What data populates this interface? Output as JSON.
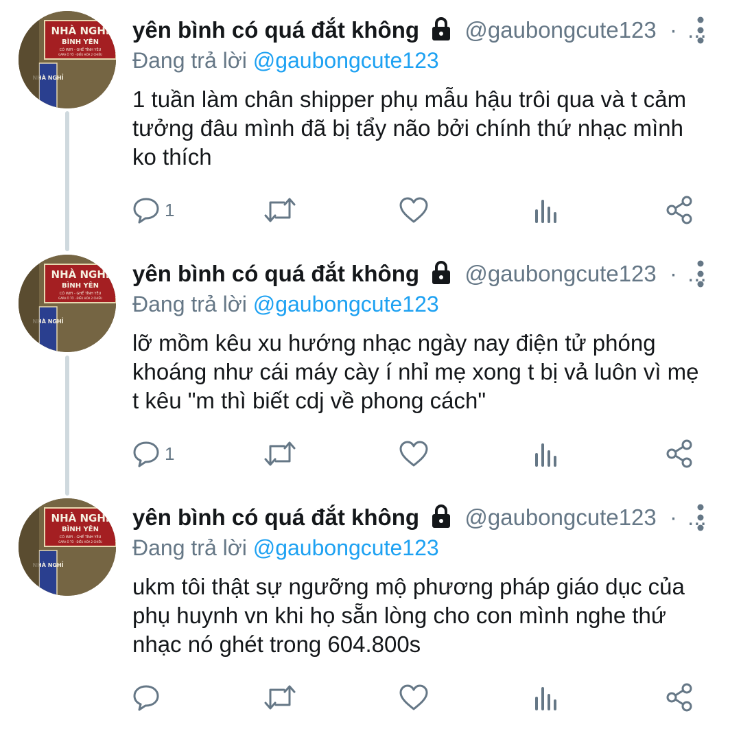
{
  "colors": {
    "text": "#14171a",
    "secondary": "#657786",
    "link": "#1da1f2",
    "thread_line": "#cfd9de"
  },
  "avatar_sign": {
    "line1": "NHÀ NGHỈ",
    "line2": "BÌNH YÊN",
    "line3": "CÓ WIFI - GHẾ TÌNH YÊU",
    "line4": "GARA Ô TÔ - ĐIỀU HÒA 2 CHIỀU",
    "side": "NHÀ NGHỈ"
  },
  "tweets": [
    {
      "display_name": "yên bình có quá đắt không",
      "handle": "@gaubongcute123",
      "separator": "·",
      "ellipsis": "...",
      "replying_prefix": "Đang trả lời",
      "replying_to": "@gaubongcute123",
      "body_lines": [
        "1 tuần làm chân shipper phụ mẫu hậu trôi qua và t cảm",
        "tưởng đâu mình đã bị tẩy não bởi chính thứ nhạc mình",
        "ko thích"
      ],
      "reply_count": "1",
      "icons": [
        "lock-icon",
        "more-vertical-icon",
        "reply-icon",
        "retweet-icon",
        "like-icon",
        "views-icon",
        "share-icon"
      ]
    },
    {
      "display_name": "yên bình có quá đắt không",
      "handle": "@gaubongcute123",
      "separator": "·",
      "ellipsis": "...",
      "replying_prefix": "Đang trả lời",
      "replying_to": "@gaubongcute123",
      "body_lines": [
        "lỡ mồm kêu xu hướng nhạc ngày nay điện tử phóng",
        "khoáng như cái máy cày í nhỉ mẹ xong t bị vả luôn vì mẹ",
        "t kêu \"m thì biết cdj về phong cách\""
      ],
      "reply_count": "1",
      "icons": [
        "lock-icon",
        "more-vertical-icon",
        "reply-icon",
        "retweet-icon",
        "like-icon",
        "views-icon",
        "share-icon"
      ]
    },
    {
      "display_name": "yên bình có quá đắt không",
      "handle": "@gaubongcute123",
      "separator": "·",
      "ellipsis": "...",
      "replying_prefix": "Đang trả lời",
      "replying_to": "@gaubongcute123",
      "body_lines": [
        "ukm tôi thật sự ngưỡng mộ phương pháp giáo dục của",
        "phụ huynh vn khi họ sẵn lòng cho con mình nghe thứ",
        "nhạc nó ghét trong 604.800s"
      ],
      "reply_count": "",
      "icons": [
        "lock-icon",
        "more-vertical-icon",
        "reply-icon",
        "retweet-icon",
        "like-icon",
        "views-icon",
        "share-icon"
      ]
    }
  ]
}
